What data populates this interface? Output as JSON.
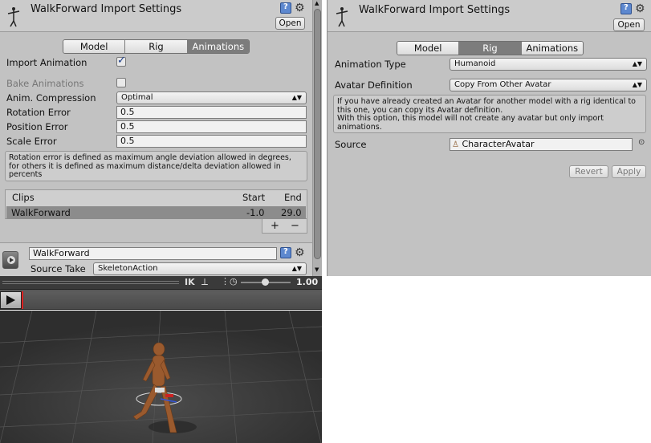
{
  "left_inspector": {
    "title": "WalkForward Import Settings",
    "open_button": "Open",
    "tabs": [
      {
        "label": "Model",
        "active": false
      },
      {
        "label": "Rig",
        "active": false
      },
      {
        "label": "Animations",
        "active": true
      }
    ],
    "import_animation": {
      "label": "Import Animation",
      "checked": true
    },
    "bake_animations": {
      "label": "Bake Animations",
      "checked": false
    },
    "anim_compression": {
      "label": "Anim. Compression",
      "value": "Optimal"
    },
    "rotation_error": {
      "label": "Rotation Error",
      "value": "0.5"
    },
    "position_error": {
      "label": "Position Error",
      "value": "0.5"
    },
    "scale_error": {
      "label": "Scale Error",
      "value": "0.5"
    },
    "help_text": "Rotation error is defined as maximum angle deviation allowed in degrees, for others it is defined as maximum distance/delta deviation allowed in percents",
    "clips": {
      "headers": {
        "name": "Clips",
        "start": "Start",
        "end": "End"
      },
      "rows": [
        {
          "name": "WalkForward",
          "start": "-1.0",
          "end": "29.0"
        }
      ],
      "add_label": "+",
      "remove_label": "−"
    },
    "clip_name": "WalkForward",
    "source_take": {
      "label": "Source Take",
      "value": "SkeletonAction"
    }
  },
  "preview": {
    "ik_label": "IK",
    "speed_value": "1.00",
    "speed_fraction": 0.5
  },
  "right_inspector": {
    "title": "WalkForward Import Settings",
    "open_button": "Open",
    "tabs": [
      {
        "label": "Model",
        "active": false
      },
      {
        "label": "Rig",
        "active": true
      },
      {
        "label": "Animations",
        "active": false
      }
    ],
    "animation_type": {
      "label": "Animation Type",
      "value": "Humanoid"
    },
    "avatar_definition": {
      "label": "Avatar Definition",
      "value": "Copy From Other Avatar"
    },
    "help_text": "If you have already created an Avatar for another model with a rig identical to this one, you can copy its Avatar definition.\nWith this option, this model will not create any avatar but only import animations.",
    "source": {
      "label": "Source",
      "value": "CharacterAvatar"
    },
    "revert_button": "Revert",
    "apply_button": "Apply"
  }
}
